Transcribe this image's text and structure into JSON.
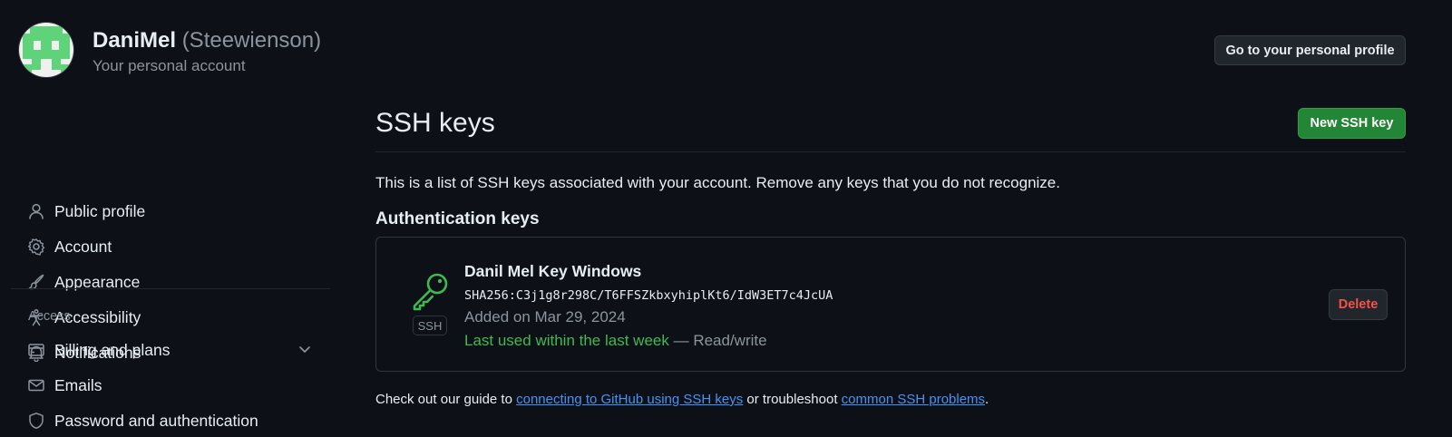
{
  "header": {
    "display_name": "DaniMel",
    "username": "(Steewienson)",
    "subtitle": "Your personal account",
    "profile_button": "Go to your personal profile"
  },
  "sidebar": {
    "items": [
      {
        "label": "Public profile",
        "icon": "person-icon"
      },
      {
        "label": "Account",
        "icon": "gear-icon"
      },
      {
        "label": "Appearance",
        "icon": "paintbrush-icon"
      },
      {
        "label": "Accessibility",
        "icon": "accessibility-icon"
      },
      {
        "label": "Notifications",
        "icon": "bell-icon"
      }
    ],
    "section_label": "Access",
    "access_items": [
      {
        "label": "Billing and plans",
        "icon": "credit-card-icon"
      },
      {
        "label": "Emails",
        "icon": "mail-icon"
      },
      {
        "label": "Password and authentication",
        "icon": "shield-lock-icon"
      }
    ]
  },
  "main": {
    "title": "SSH keys",
    "new_key_button": "New SSH key",
    "intro": "This is a list of SSH keys associated with your account. Remove any keys that you do not recognize.",
    "section_heading": "Authentication keys",
    "key": {
      "badge": "SSH",
      "name": "Danil Mel Key Windows",
      "fingerprint": "SHA256:C3j1g8r298C/T6FFSZkbxyhiplKt6/IdW3ET7c4JcUA",
      "added": "Added on Mar 29, 2024",
      "last_used": "Last used within the last week",
      "access": "— Read/write",
      "delete_button": "Delete"
    },
    "footer": {
      "prefix": "Check out our guide to ",
      "link1": "connecting to GitHub using SSH keys",
      "middle": " or troubleshoot ",
      "link2": "common SSH problems",
      "suffix": "."
    }
  },
  "colors": {
    "background": "#0d1117",
    "text": "#e6edf3",
    "muted": "#8b949e",
    "primary_green": "#238636",
    "success_text": "#3fb950",
    "danger": "#f85149",
    "link": "#4493f8"
  }
}
